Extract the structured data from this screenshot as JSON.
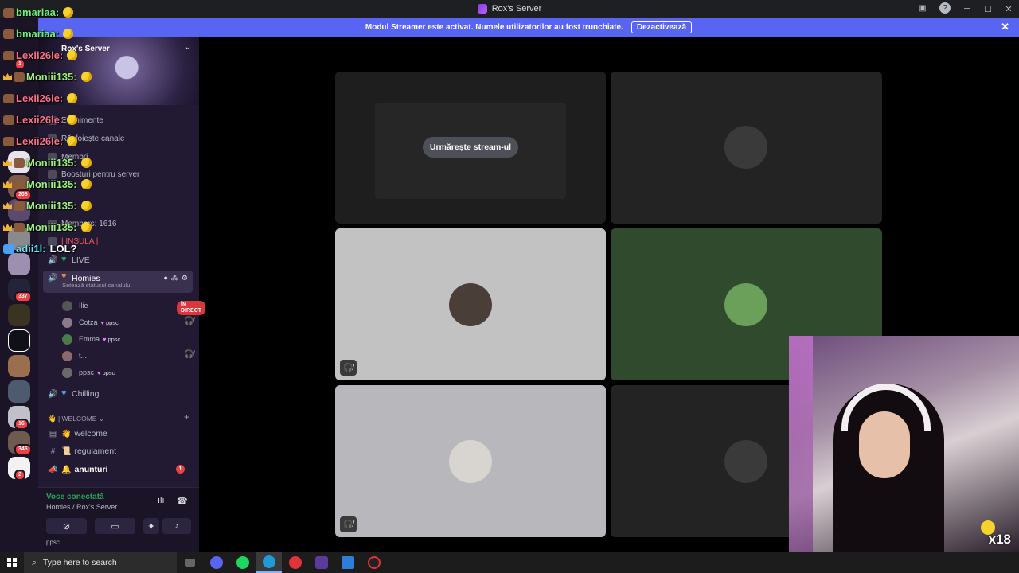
{
  "window": {
    "title": "Rox's Server",
    "controls": {
      "minimize": "─",
      "maximize": "☐",
      "close": "✕"
    },
    "toolbar_icons": [
      "inbox-icon",
      "help-icon"
    ]
  },
  "streamer_banner": {
    "text": "Modul Streamer este activat. Numele utilizatorilor au fost trunchiate.",
    "button_label": "Dezactivează",
    "close": "✕"
  },
  "server_rail": {
    "badges": [
      "1",
      "206",
      "337",
      "16",
      "346",
      "2"
    ]
  },
  "sidebar": {
    "server_name": "Rox's Server",
    "menu": [
      {
        "label": "Evenimente",
        "icon": "calendar-icon"
      },
      {
        "label": "Răsfoiește canale",
        "icon": "browse-icon"
      },
      {
        "label": "Membri",
        "icon": "members-icon"
      },
      {
        "label": "Boosturi pentru server",
        "icon": "boost-icon"
      }
    ],
    "members_label": "Members: 1616",
    "insula_label": "| INSULA |",
    "channels": {
      "live": "LIVE",
      "homies": "Homies",
      "homies_status": "Setează statusul canalului",
      "chilling": "Chilling",
      "welcome_category": "| WELCOME",
      "welcome": "welcome",
      "regulament": "regulament",
      "anunturi": "anunturi",
      "anunturi_badge": "1"
    },
    "voice_users": [
      {
        "name": "Ilie",
        "tag": "",
        "live": "ÎN DIRECT"
      },
      {
        "name": "Cotza",
        "tag": "ppsc"
      },
      {
        "name": "Emma",
        "tag": "ppsc"
      },
      {
        "name": "t...",
        "tag": ""
      },
      {
        "name": "ppsc",
        "tag": "ppsc"
      }
    ],
    "voice_panel": {
      "title": "Voce conectată",
      "subtitle": "Homies / Rox's Server",
      "user": "ppsc"
    }
  },
  "chat": [
    {
      "user": "bmariaa:",
      "color": "#6ef07a",
      "msg": ""
    },
    {
      "user": "bmariaa:",
      "color": "#6ef07a",
      "msg": ""
    },
    {
      "user": "Lexii26le:",
      "color": "#ff6e8a",
      "msg": ""
    },
    {
      "user": "Moniii135:",
      "color": "#9df27a",
      "msg": ""
    },
    {
      "user": "Lexii26le:",
      "color": "#ff6e8a",
      "msg": ""
    },
    {
      "user": "Lexii26le:",
      "color": "#ff6e8a",
      "msg": ""
    },
    {
      "user": "Lexii26le:",
      "color": "#ff6e8a",
      "msg": ""
    },
    {
      "user": "Moniii135:",
      "color": "#9df27a",
      "msg": ""
    },
    {
      "user": "Moniii135:",
      "color": "#9df27a",
      "msg": ""
    },
    {
      "user": "Moniii135:",
      "color": "#9df27a",
      "msg": ""
    },
    {
      "user": "Moniii135:",
      "color": "#9df27a",
      "msg": ""
    },
    {
      "user": "adii1l:",
      "color": "#6fe3ff",
      "msg": "LOL?"
    }
  ],
  "stage": {
    "watch_stream_label": "Urmărește stream-ul"
  },
  "webcam": {
    "multiplier": "x18"
  },
  "taskbar": {
    "search_placeholder": "Type here to search"
  },
  "colors": {
    "accent": "#5865f2",
    "live_red": "#da373c",
    "connected_green": "#23a55a"
  }
}
